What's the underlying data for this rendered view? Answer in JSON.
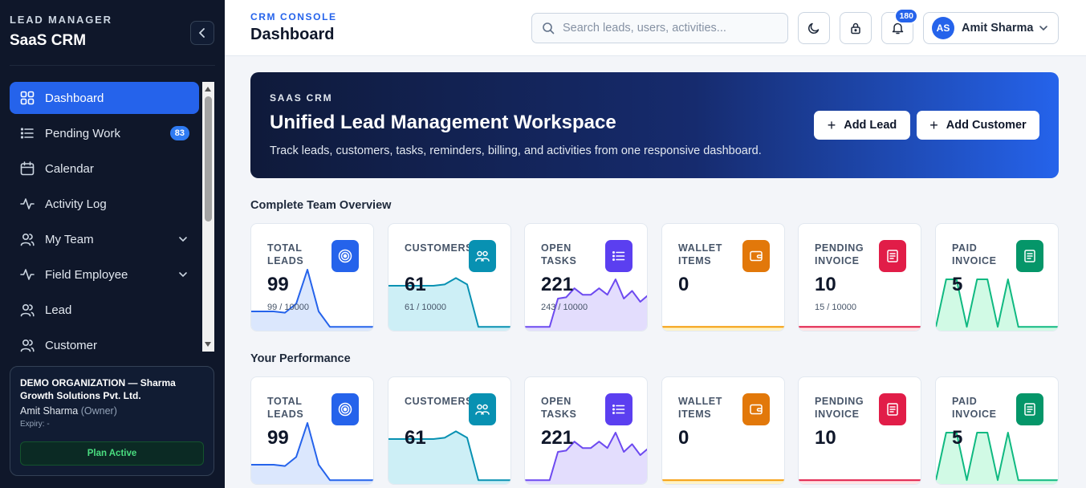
{
  "sidebar": {
    "eyebrow": "LEAD MANAGER",
    "brand": "SaaS CRM",
    "items": [
      {
        "label": "Dashboard",
        "icon": "grid-icon",
        "active": true
      },
      {
        "label": "Pending Work",
        "icon": "list-icon",
        "badge": "83"
      },
      {
        "label": "Calendar",
        "icon": "calendar-icon"
      },
      {
        "label": "Activity Log",
        "icon": "pulse-icon"
      },
      {
        "label": "My Team",
        "icon": "users-icon",
        "expandable": true
      },
      {
        "label": "Field Employee",
        "icon": "pulse-icon",
        "expandable": true
      },
      {
        "label": "Lead",
        "icon": "users-icon"
      },
      {
        "label": "Customer",
        "icon": "users-icon"
      }
    ],
    "org": {
      "name": "DEMO ORGANIZATION — Sharma Growth Solutions Pvt. Ltd.",
      "user": "Amit Sharma",
      "role": "(Owner)",
      "expiry": "Expiry: -",
      "plan": "Plan Active"
    }
  },
  "header": {
    "crumb": "CRM CONSOLE",
    "title": "Dashboard",
    "search_placeholder": "Search leads, users, activities...",
    "notifications": "180",
    "user_initials": "AS",
    "user_name": "Amit Sharma"
  },
  "hero": {
    "eyebrow": "SAAS CRM",
    "title": "Unified Lead Management Workspace",
    "subtitle": "Track leads, customers, tasks, reminders, billing, and activities from one responsive dashboard.",
    "add_lead": "Add Lead",
    "add_customer": "Add Customer"
  },
  "sections": [
    {
      "title": "Complete Team Overview",
      "cards": [
        {
          "label": "TOTAL LEADS",
          "value": "99",
          "sub": "99 / 10000",
          "icon": "target-icon",
          "color": "#2563eb",
          "fill": "#dbe7fd",
          "spark": [
            0.3,
            0.3,
            0.3,
            0.28,
            0.42,
            0.95,
            0.3,
            0.06,
            0.06,
            0.06,
            0.06,
            0.06
          ]
        },
        {
          "label": "CUSTOMERS",
          "value": "61",
          "sub": "61 / 10000",
          "icon": "team-icon",
          "color": "#0891b2",
          "fill": "#cdeff6",
          "spark": [
            0.7,
            0.7,
            0.7,
            0.7,
            0.7,
            0.72,
            0.82,
            0.72,
            0.06,
            0.06,
            0.06,
            0.06
          ]
        },
        {
          "label": "OPEN TASKS",
          "value": "221",
          "sub": "243 / 10000",
          "icon": "list-icon",
          "color": "#6d4af0",
          "fill": "#e3ddfd",
          "spark": [
            0.06,
            0.06,
            0.06,
            0.06,
            0.5,
            0.52,
            0.66,
            0.56,
            0.56,
            0.66,
            0.56,
            0.8,
            0.5,
            0.62,
            0.45,
            0.56
          ]
        },
        {
          "label": "WALLET ITEMS",
          "value": "0",
          "sub": "",
          "icon": "wallet-icon",
          "color": "#f59e0b",
          "fill": "#fef3c7",
          "spark": [
            0.06,
            0.06,
            0.06,
            0.06,
            0.06,
            0.06,
            0.06,
            0.06,
            0.06,
            0.06,
            0.06,
            0.06
          ]
        },
        {
          "label": "PENDING INVOICE",
          "value": "10",
          "sub": "15 / 10000",
          "icon": "invoice-icon",
          "color": "#e11d48",
          "fill": "#ffe4e6",
          "spark": [
            0.06,
            0.06,
            0.06,
            0.06,
            0.06,
            0.06,
            0.06,
            0.06,
            0.06,
            0.06,
            0.06,
            0.06
          ]
        },
        {
          "label": "PAID INVOICE",
          "value": "5",
          "sub": "",
          "icon": "receipt-icon",
          "color": "#10b981",
          "fill": "#d1fae5",
          "spark": [
            0.06,
            0.8,
            0.8,
            0.06,
            0.8,
            0.8,
            0.06,
            0.8,
            0.06,
            0.06,
            0.06,
            0.06,
            0.06
          ]
        }
      ]
    },
    {
      "title": "Your Performance",
      "cards": [
        {
          "label": "TOTAL LEADS",
          "value": "99",
          "sub": "",
          "icon": "target-icon",
          "color": "#2563eb",
          "fill": "#dbe7fd",
          "spark": [
            0.3,
            0.3,
            0.3,
            0.28,
            0.42,
            0.95,
            0.3,
            0.06,
            0.06,
            0.06,
            0.06,
            0.06
          ]
        },
        {
          "label": "CUSTOMERS",
          "value": "61",
          "sub": "",
          "icon": "team-icon",
          "color": "#0891b2",
          "fill": "#cdeff6",
          "spark": [
            0.7,
            0.7,
            0.7,
            0.7,
            0.7,
            0.72,
            0.82,
            0.72,
            0.06,
            0.06,
            0.06,
            0.06
          ]
        },
        {
          "label": "OPEN TASKS",
          "value": "221",
          "sub": "",
          "icon": "list-icon",
          "color": "#6d4af0",
          "fill": "#e3ddfd",
          "spark": [
            0.06,
            0.06,
            0.06,
            0.06,
            0.5,
            0.52,
            0.66,
            0.56,
            0.56,
            0.66,
            0.56,
            0.8,
            0.5,
            0.62,
            0.45,
            0.56
          ]
        },
        {
          "label": "WALLET ITEMS",
          "value": "0",
          "sub": "",
          "icon": "wallet-icon",
          "color": "#f59e0b",
          "fill": "#fef3c7",
          "spark": [
            0.06,
            0.06,
            0.06,
            0.06,
            0.06,
            0.06,
            0.06,
            0.06,
            0.06,
            0.06,
            0.06,
            0.06
          ]
        },
        {
          "label": "PENDING INVOICE",
          "value": "10",
          "sub": "",
          "icon": "invoice-icon",
          "color": "#e11d48",
          "fill": "#ffe4e6",
          "spark": [
            0.06,
            0.06,
            0.06,
            0.06,
            0.06,
            0.06,
            0.06,
            0.06,
            0.06,
            0.06,
            0.06,
            0.06
          ]
        },
        {
          "label": "PAID INVOICE",
          "value": "5",
          "sub": "",
          "icon": "receipt-icon",
          "color": "#10b981",
          "fill": "#d1fae5",
          "spark": [
            0.06,
            0.8,
            0.8,
            0.06,
            0.8,
            0.8,
            0.06,
            0.8,
            0.06,
            0.06,
            0.06,
            0.06,
            0.06
          ]
        }
      ]
    }
  ]
}
